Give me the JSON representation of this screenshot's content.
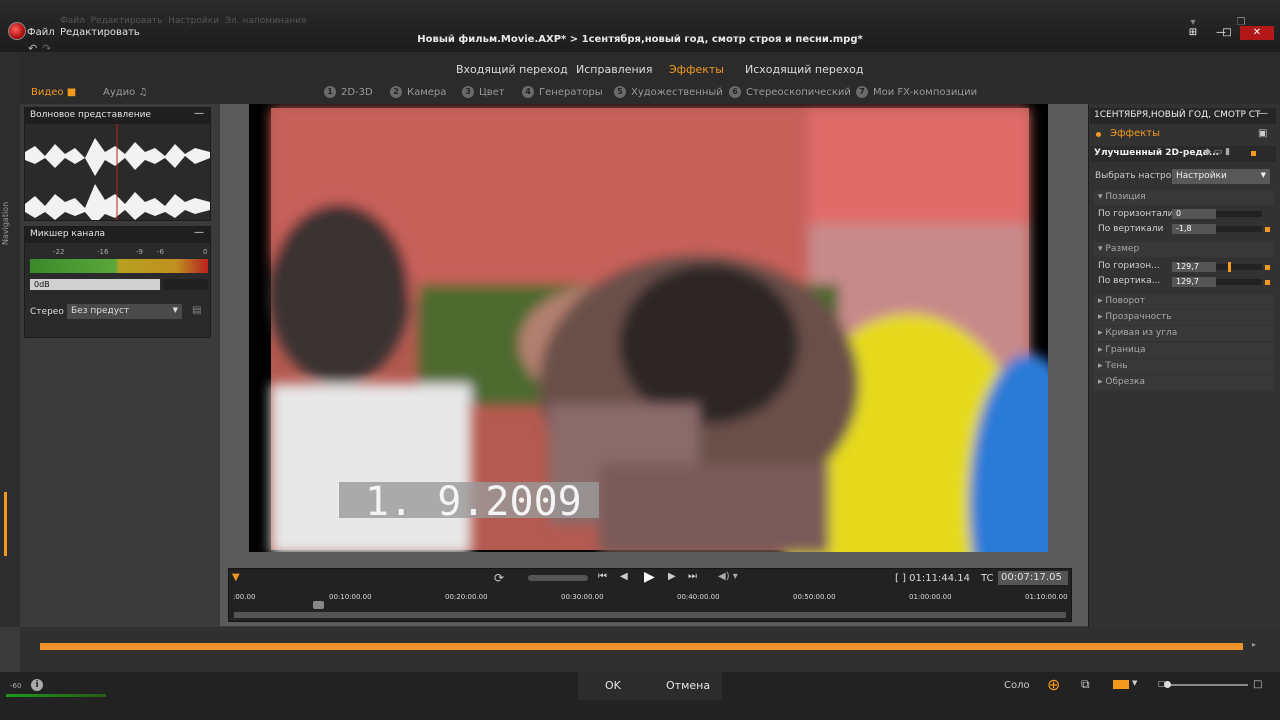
{
  "menu": {
    "file": "Файл",
    "edit": "Редактировать",
    "ghost_items": [
      "Файл",
      "Редактировать",
      "Настройки",
      "Эл. напоминания"
    ]
  },
  "title": "Новый фильм.Movie.AXP*  >  1сентября,новый год, смотр строя и песни.mpg*",
  "tabs": [
    {
      "label": "Входящий переход",
      "active": false
    },
    {
      "label": "Исправления",
      "active": false
    },
    {
      "label": "Эффекты",
      "active": true
    },
    {
      "label": "Исходящий переход",
      "active": false
    }
  ],
  "subtabs": [
    {
      "num": "1",
      "label": "2D-3D"
    },
    {
      "num": "2",
      "label": "Камера"
    },
    {
      "num": "3",
      "label": "Цвет"
    },
    {
      "num": "4",
      "label": "Генераторы"
    },
    {
      "num": "5",
      "label": "Художественный"
    },
    {
      "num": "6",
      "label": "Стереоскопический"
    },
    {
      "num": "7",
      "label": "Мои FX-композиции"
    }
  ],
  "mode": {
    "video": "Видео",
    "audio": "Аудио"
  },
  "nav_label": "Navigation",
  "waveform": {
    "title": "Волновое представление"
  },
  "mixer": {
    "title": "Микшер канала",
    "scale": [
      "-22",
      "-16",
      "-9",
      "-6",
      "0"
    ],
    "level": "0dB",
    "stereo_label": "Стерео",
    "preset": "Без предуст"
  },
  "preview": {
    "date_overlay": "1.  9.2009"
  },
  "transport": {
    "timecode": "[ ] 01:11:44.14",
    "tc_label": "TC",
    "tc_value": "00:07:17.05",
    "ruler": [
      ":00.00",
      "00:10:00.00",
      "00:20:00.00",
      "00:30:00.00",
      "00:40:00.00",
      "00:50:00.00",
      "01:00:00.00",
      "01:10:00.00"
    ]
  },
  "right": {
    "clip_title": "1СЕНТЯБРЯ,НОВЫЙ ГОД, СМОТР СТ",
    "effects_label": "Эффекты",
    "effect_name": "Улучшенный 2D-реда...",
    "preset_label": "Выбрать настрой",
    "preset_value": "Настройки",
    "position_label": "Позиция",
    "hpos_label": "По горизонтали",
    "hpos_value": "0",
    "vpos_label": "По вертикали",
    "vpos_value": "-1,8",
    "size_label": "Размер",
    "hsize_label": "По горизон...",
    "hsize_value": "129,7",
    "vsize_label": "По вертика...",
    "vsize_value": "129,7",
    "sections": [
      "Поворот",
      "Прозрачность",
      "Кривая из угла",
      "Граница",
      "Тень",
      "Обрезка"
    ]
  },
  "bottom": {
    "ok": "OK",
    "cancel": "Отмена",
    "solo": "Соло",
    "vol": "-60"
  },
  "colors": {
    "accent": "#f39a1e",
    "close": "#b31818"
  }
}
